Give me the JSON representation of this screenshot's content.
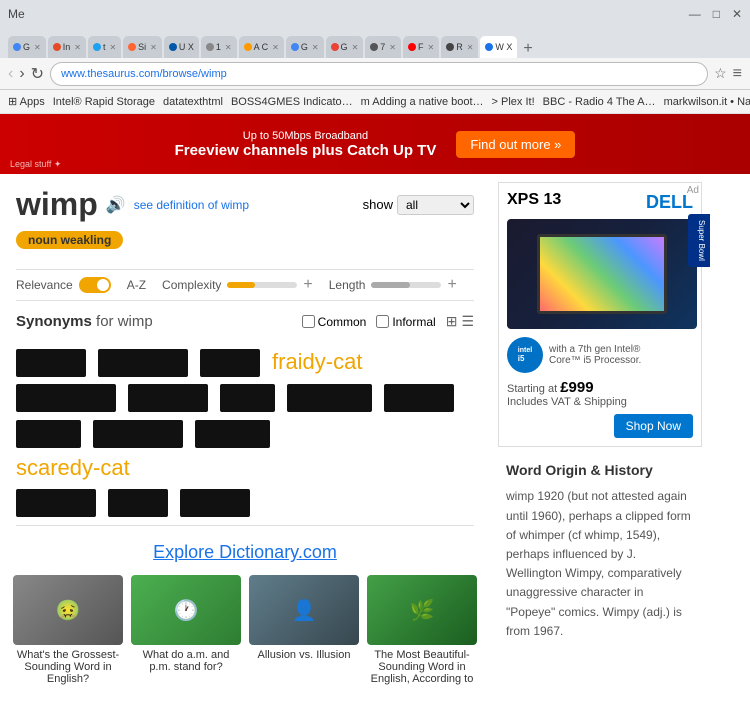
{
  "window": {
    "title": "Me",
    "minimize": "—",
    "maximize": "□",
    "close": "✕"
  },
  "tabs": [
    {
      "id": "g",
      "label": "G",
      "color": "#4285f4",
      "active": false
    },
    {
      "id": "in",
      "label": "In",
      "color": "#e34c26",
      "active": false
    },
    {
      "id": "t1",
      "label": "t 1",
      "color": "#1da1f2",
      "active": false
    },
    {
      "id": "si",
      "label": "Si",
      "color": "#ff6633",
      "active": false
    },
    {
      "id": "u",
      "label": "U X",
      "color": "#0057a8",
      "active": false
    },
    {
      "id": "1",
      "label": "1",
      "color": "#888",
      "active": false
    },
    {
      "id": "am",
      "label": "A C",
      "color": "#ff9900",
      "active": false
    },
    {
      "id": "gc",
      "label": "G",
      "color": "#4285f4",
      "active": false
    },
    {
      "id": "gm",
      "label": "G",
      "color": "#ea4335",
      "active": false
    },
    {
      "id": "7",
      "label": "7 ✕",
      "color": "#555",
      "active": false
    },
    {
      "id": "yt",
      "label": "F ✕",
      "color": "#ff0000",
      "active": false
    },
    {
      "id": "rx",
      "label": "R ✕",
      "color": "#444",
      "active": false
    },
    {
      "id": "wx",
      "label": "W X",
      "color": "#1a73e8",
      "active": true
    }
  ],
  "nav": {
    "back": "‹",
    "forward": "›",
    "refresh": "↻",
    "url": "www.thesaurus.com/browse/wimp",
    "star": "☆",
    "menu": "≡"
  },
  "bookmarks": [
    {
      "label": "Apps"
    },
    {
      "label": "Intel® Rapid Storage"
    },
    {
      "label": "datatexthtml"
    },
    {
      "label": "BOSS4GMES Indicato"
    },
    {
      "label": "Adding a native boot"
    },
    {
      "label": "> Plex It!"
    },
    {
      "label": "BBC - Radio 4 The A"
    },
    {
      "label": "markwilson.it • Nativ"
    }
  ],
  "ad_banner": {
    "line1": "Up to 50Mbps Broadband",
    "line2": "Freeview channels plus Catch Up TV",
    "button": "Find out more »",
    "legal": "Legal stuff ✦"
  },
  "page": {
    "word": "wimp",
    "sound_icon": "🔊",
    "see_definition": "see definition of wimp",
    "show_label": "show",
    "show_value": "all",
    "tag": "noun weakling"
  },
  "filters": {
    "relevance_label": "Relevance",
    "az_label": "A-Z",
    "complexity_label": "Complexity",
    "length_label": "Length",
    "complexity_value": 40,
    "length_value": 55
  },
  "synonyms": {
    "title": "Synonyms",
    "for_word": "for wimp",
    "common_label": "Common",
    "informal_label": "Informal",
    "view_grid": "⊞",
    "view_list": "☰"
  },
  "words": [
    {
      "text": "fraidy-cat",
      "type": "orange",
      "show": true
    },
    {
      "text": "scaredy-cat",
      "type": "orange",
      "show": true
    }
  ],
  "explore": {
    "title": "Explore Dictionary.com",
    "cards": [
      {
        "label": "What's the Grossest-Sounding Word in English?",
        "img_type": "grossest"
      },
      {
        "label": "What do a.m. and p.m. stand for?",
        "img_type": "ampm"
      },
      {
        "label": "Allusion vs. Illusion",
        "img_type": "allusion"
      },
      {
        "label": "The Most Beautiful-Sounding Word in English, According to",
        "img_type": "beautiful"
      }
    ]
  },
  "dell_ad": {
    "title": "XPS 13",
    "intel_text1": "with a 7th gen Intel®",
    "intel_text2": "Core™ i5 Processor.",
    "price_prefix": "Starting at",
    "price": "£999",
    "price_suffix": "Includes VAT & Shipping",
    "shop_btn": "Shop Now",
    "ad_label": "Ad"
  },
  "word_origin": {
    "title": "Word Origin & History",
    "text": "wimp 1920 (but not attested again until 1960), perhaps a clipped form of whimper (cf whimp, 1549), perhaps influenced by J. Wellington Wimpy, comparatively unaggressive character in \"Popeye\" comics. Wimpy (adj.) is from 1967."
  },
  "super_bowl": {
    "label": "Super Bowl"
  }
}
